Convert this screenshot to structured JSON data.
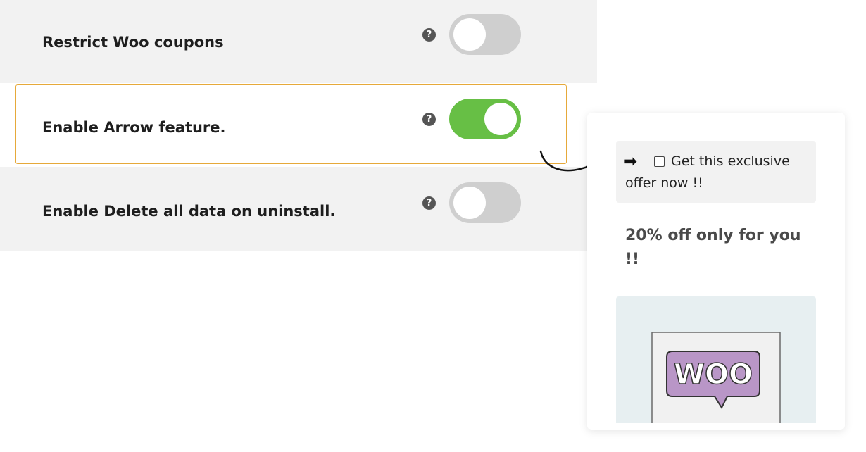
{
  "settings": {
    "rows": [
      {
        "label": "Restrict Woo coupons",
        "help": "?",
        "enabled": false
      },
      {
        "label": "Enable Arrow feature.",
        "help": "?",
        "enabled": true
      },
      {
        "label": "Enable Delete all data on uninstall.",
        "help": "?",
        "enabled": false
      }
    ]
  },
  "preview": {
    "arrow_glyph": "➡",
    "offer_checkbox_checked": false,
    "offer_text": "Get this exclusive offer now !!",
    "promo_text": "20% off only for you !!",
    "image_logo_text": "WOO"
  },
  "colors": {
    "toggle_on": "#67bf45",
    "toggle_off": "#cfcfcf",
    "highlight_border": "#e6a93a",
    "row_background": "#f2f2f2",
    "logo_fill": "#b996c7"
  }
}
